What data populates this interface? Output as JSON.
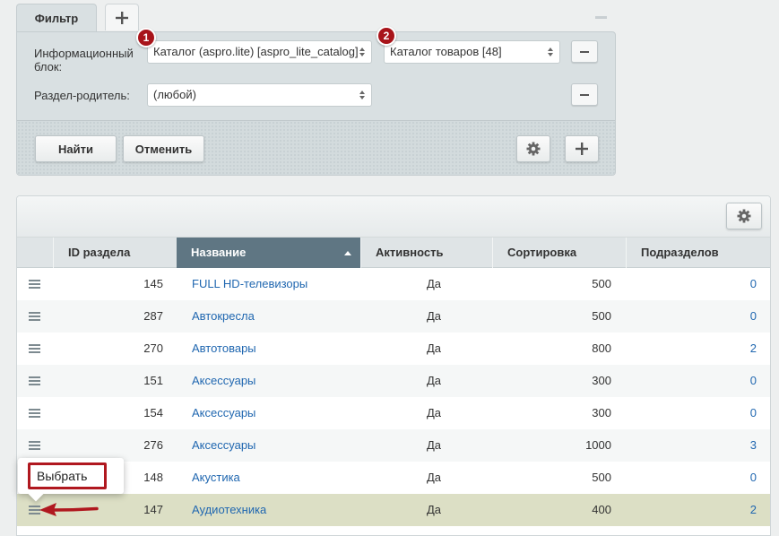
{
  "filter": {
    "tab_label": "Фильтр",
    "add_tab_label": "+",
    "fields": [
      {
        "label": "Информационный блок:",
        "selects": [
          {
            "value": "Каталог (aspro.lite) [aspro_lite_catalog]"
          },
          {
            "value": "Каталог товаров [48]"
          }
        ]
      },
      {
        "label": "Раздел-родитель:",
        "selects": [
          {
            "value": "(любой)"
          }
        ]
      }
    ],
    "badges": [
      "1",
      "2"
    ],
    "buttons": {
      "find": "Найти",
      "cancel": "Отменить"
    }
  },
  "grid": {
    "columns": [
      "ID раздела",
      "Название",
      "Активность",
      "Сортировка",
      "Подразделов"
    ],
    "sorted_column": "Название",
    "rows": [
      {
        "id": "145",
        "name": "FULL HD-телевизоры",
        "active": "Да",
        "sort": "500",
        "sub": "0"
      },
      {
        "id": "287",
        "name": "Автокресла",
        "active": "Да",
        "sort": "500",
        "sub": "0"
      },
      {
        "id": "270",
        "name": "Автотовары",
        "active": "Да",
        "sort": "800",
        "sub": "2"
      },
      {
        "id": "151",
        "name": "Аксессуары",
        "active": "Да",
        "sort": "300",
        "sub": "0"
      },
      {
        "id": "154",
        "name": "Аксессуары",
        "active": "Да",
        "sort": "300",
        "sub": "0"
      },
      {
        "id": "276",
        "name": "Аксессуары",
        "active": "Да",
        "sort": "1000",
        "sub": "3"
      },
      {
        "id": "148",
        "name": "Акустика",
        "active": "Да",
        "sort": "500",
        "sub": "0"
      },
      {
        "id": "147",
        "name": "Аудиотехника",
        "active": "Да",
        "sort": "400",
        "sub": "2"
      }
    ]
  },
  "context_menu": {
    "item": "Выбрать"
  },
  "colors": {
    "link": "#2067b0",
    "sorted_header": "#5f7683",
    "highlight_row": "#dcdfc5",
    "annotation_red": "#b0181f"
  }
}
